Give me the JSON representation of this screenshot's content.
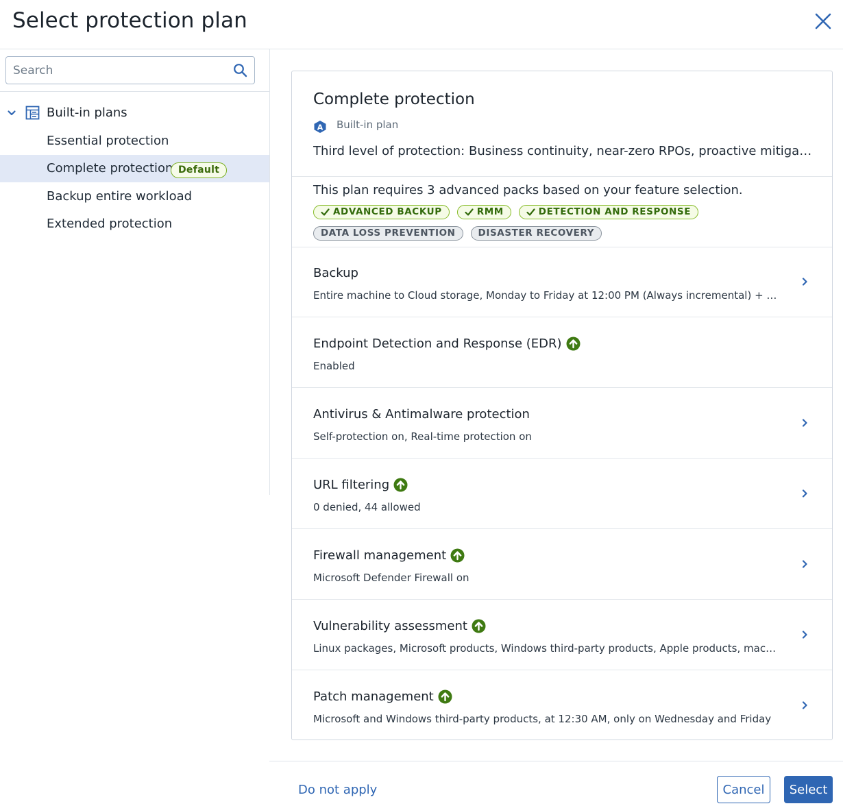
{
  "header": {
    "title": "Select protection plan"
  },
  "sidebar": {
    "search": {
      "placeholder": "Search",
      "value": ""
    },
    "group": {
      "label": "Built-in plans"
    },
    "items": [
      {
        "label": "Essential protection"
      },
      {
        "label": "Complete protection",
        "badge": "Default",
        "selected": true
      },
      {
        "label": "Backup entire workload"
      },
      {
        "label": "Extended protection"
      }
    ]
  },
  "plan": {
    "name": "Complete protection",
    "type_label": "Built-in plan",
    "type_icon_letter": "A",
    "description": "Third level of protection: Business continuity, near-zero RPOs, proactive mitigation of..."
  },
  "packs": {
    "summary": "This plan requires 3 advanced packs based on your feature selection.",
    "required": [
      "ADVANCED BACKUP",
      "RMM",
      "DETECTION AND RESPONSE"
    ],
    "other": [
      "DATA LOSS PREVENTION",
      "DISASTER RECOVERY"
    ]
  },
  "sections": [
    {
      "title": "Backup",
      "subtitle": "Entire machine to Cloud storage, Monday to Friday at 12:00 PM (Always incremental) + CDP",
      "upgrade": false,
      "expandable": true
    },
    {
      "title": "Endpoint Detection and Response (EDR)",
      "subtitle": "Enabled",
      "upgrade": true,
      "expandable": false
    },
    {
      "title": "Antivirus & Antimalware protection",
      "subtitle": "Self-protection on, Real-time protection on",
      "upgrade": false,
      "expandable": true
    },
    {
      "title": "URL filtering",
      "subtitle": "0 denied, 44 allowed",
      "upgrade": true,
      "expandable": true
    },
    {
      "title": "Firewall management",
      "subtitle": "Microsoft Defender Firewall on",
      "upgrade": true,
      "expandable": true
    },
    {
      "title": "Vulnerability assessment",
      "subtitle": "Linux packages, Microsoft products, Windows third-party products, Apple products, macOS t...",
      "upgrade": true,
      "expandable": true
    },
    {
      "title": "Patch management",
      "subtitle": "Microsoft and Windows third-party products, at 12:30 AM, only on Wednesday and Friday",
      "upgrade": true,
      "expandable": true
    }
  ],
  "footer": {
    "do_not_apply": "Do not apply",
    "cancel": "Cancel",
    "select": "Select"
  },
  "colors": {
    "accent": "#2f66b3",
    "selected_bg": "#e1e8f6",
    "upgrade_green": "#3f7a12",
    "pack_ok_border": "#86bb28"
  },
  "icons": {
    "close": "close-icon",
    "search": "search-icon",
    "chevron": "chevron-right-icon",
    "upgrade": "upgrade-arrow-icon",
    "plan": "plan-table-icon"
  }
}
